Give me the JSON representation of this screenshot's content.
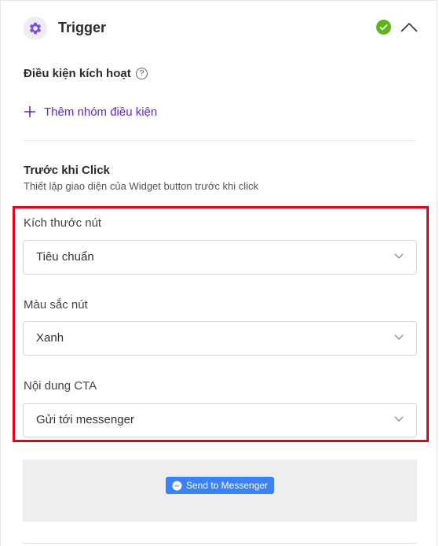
{
  "header": {
    "title": "Trigger",
    "status": "complete",
    "expanded": true
  },
  "trigger_conditions": {
    "label": "Điều kiện kích hoạt",
    "help_symbol": "?",
    "add_group_label": "Thêm nhóm điều kiện"
  },
  "before_click": {
    "title": "Trước khi Click",
    "description": "Thiết lập giao diện của Widget button trước khi click"
  },
  "fields": [
    {
      "label": "Kích thước nút",
      "value": "Tiêu chuẩn"
    },
    {
      "label": "Màu sắc nút",
      "value": "Xanh"
    },
    {
      "label": "Nội dung CTA",
      "value": "Gửi tới messenger"
    }
  ],
  "preview": {
    "button_label": "Send to Messenger"
  },
  "colors": {
    "accent": "#5b2bd6",
    "success": "#58b81a",
    "highlight": "#e8001c",
    "messenger": "#3b82f6"
  }
}
